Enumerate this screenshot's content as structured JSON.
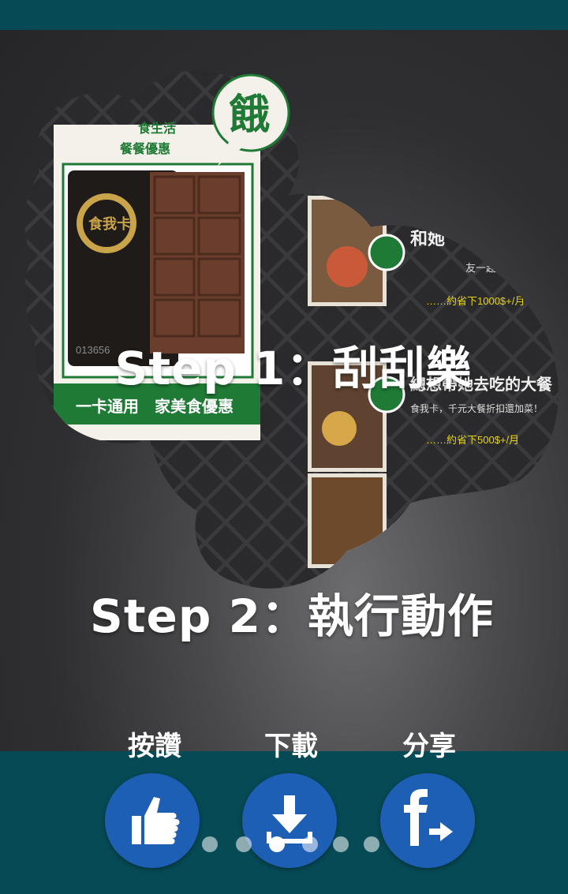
{
  "colors": {
    "topbar": "#064a55",
    "bottom_panel": "#064a55",
    "button_fill": "#1d5fb5",
    "promo_green": "#1e7a34",
    "price_yellow": "#e6d21a"
  },
  "steps": {
    "step1": "Step 1：刮刮樂",
    "step2": "Step 2：執行動作"
  },
  "promo": {
    "card_subtitle_line1": "食生活",
    "card_subtitle_line2": "餐餐優惠",
    "card_number": "013656",
    "card_logo_text": "食我卡",
    "card_banner": "一卡通用　家美食優惠",
    "hungry_char": "餓",
    "row1_title": "和她",
    "row1_subtitle": "友一起普享折扣！",
    "row1_price": "……約省下1000$+/月",
    "row2_title": "總想帶她去吃的大餐",
    "row2_subtitle": "食我卡，千元大餐折扣還加菜！",
    "row2_price": "……約省下500$+/月"
  },
  "actions": [
    {
      "label": "按讚",
      "icon": "thumbs-up-icon"
    },
    {
      "label": "下載",
      "icon": "download-icon"
    },
    {
      "label": "分享",
      "icon": "facebook-share-icon"
    }
  ],
  "pagination": {
    "total": 6,
    "active_index": 2
  }
}
